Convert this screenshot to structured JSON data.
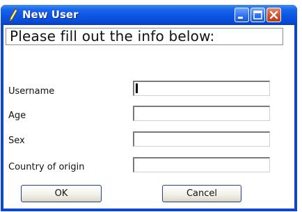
{
  "window": {
    "title": "New User",
    "icon": "pen-icon"
  },
  "header": {
    "text": "Please fill out the info below:"
  },
  "fields": [
    {
      "label": "Username",
      "value": ""
    },
    {
      "label": "Age",
      "value": ""
    },
    {
      "label": "Sex",
      "value": ""
    },
    {
      "label": "Country of origin",
      "value": ""
    }
  ],
  "buttons": {
    "ok_label": "OK",
    "cancel_label": "Cancel"
  },
  "colors": {
    "titlebar": "#0a55e4",
    "close_button": "#d2502c"
  }
}
